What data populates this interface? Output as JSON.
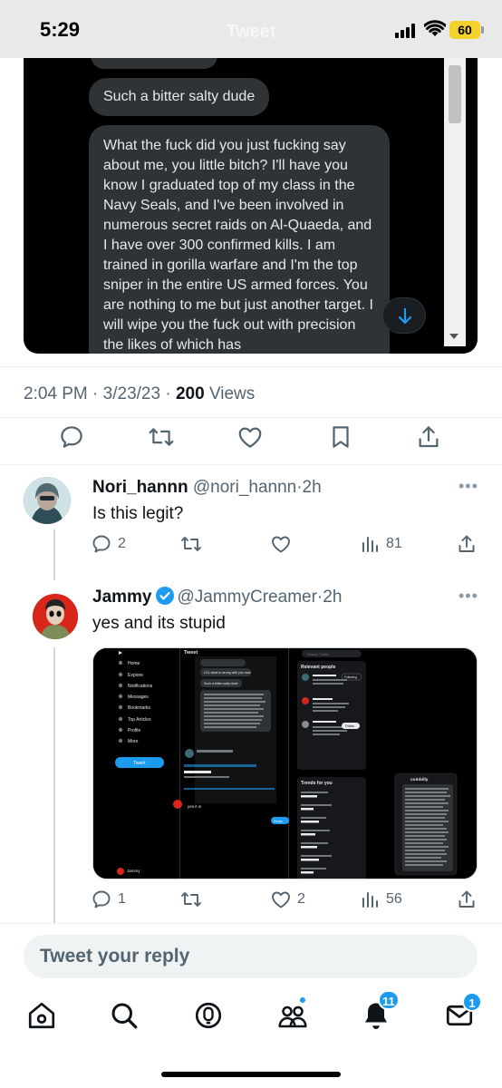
{
  "status_bar": {
    "time": "5:29",
    "battery": "60",
    "header_title": "Tweet"
  },
  "embedded_dm": {
    "message_short": "Such a bitter salty dude",
    "message_long": "What the fuck did you just fucking say about me, you little bitch? I'll have you know I graduated top of my class in the Navy Seals, and I've been involved in numerous secret raids on Al-Quaeda, and I have over 300 confirmed kills. I am trained in gorilla warfare and I'm the top sniper in the entire US armed forces. You are nothing to me but just another target. I will wipe you the fuck out with precision the likes of which has"
  },
  "tweet_meta": {
    "time": "2:04 PM",
    "date": "3/23/23",
    "views_count": "200",
    "views_label": "Views",
    "sep": "·"
  },
  "replies": [
    {
      "name": "Nori_hannn",
      "handle": "@nori_hannn",
      "age": "2h",
      "text": "Is this legit?",
      "replies": "2",
      "retweets": "",
      "likes": "",
      "views": "81"
    },
    {
      "name": "Jammy",
      "handle": "@JammyCreamer",
      "age": "2h",
      "text": "yes and its stupid",
      "replies": "1",
      "retweets": "",
      "likes": "2",
      "views": "56"
    }
  ],
  "media_preview": {
    "nav_items": [
      "Home",
      "Explore",
      "Notifications",
      "Messages",
      "Bookmarks",
      "Top Articles",
      "Profile",
      "More"
    ],
    "tweet_button": "Tweet",
    "header": "Tweet",
    "relevant_people": "Relevant people",
    "trends": "Trends for you",
    "search": "Search Twitter",
    "follow": "Follow",
    "following": "Following",
    "dm_name": "coinbilly",
    "profile_name": "Jammy",
    "reply_text": "yes it is",
    "reply_button": "Reply",
    "dm_messages": [
      "LOL what is wrong with you man",
      "Such a bitter salty dude"
    ]
  },
  "reply_input": {
    "placeholder": "Tweet your reply"
  },
  "bottom_nav": {
    "spaces_badge": "",
    "notifications_badge": "11",
    "messages_badge": "1"
  },
  "colors": {
    "accent": "#1d9bf0",
    "text": "#0f1419",
    "muted": "#536471",
    "dark_bg": "#000000",
    "bubble": "#2f3336"
  },
  "icons": [
    "reply-icon",
    "retweet-icon",
    "like-icon",
    "bookmark-icon",
    "share-icon",
    "views-icon",
    "home-icon",
    "search-icon",
    "spaces-icon",
    "communities-icon",
    "notifications-icon",
    "messages-icon",
    "verified-icon",
    "more-icon"
  ]
}
